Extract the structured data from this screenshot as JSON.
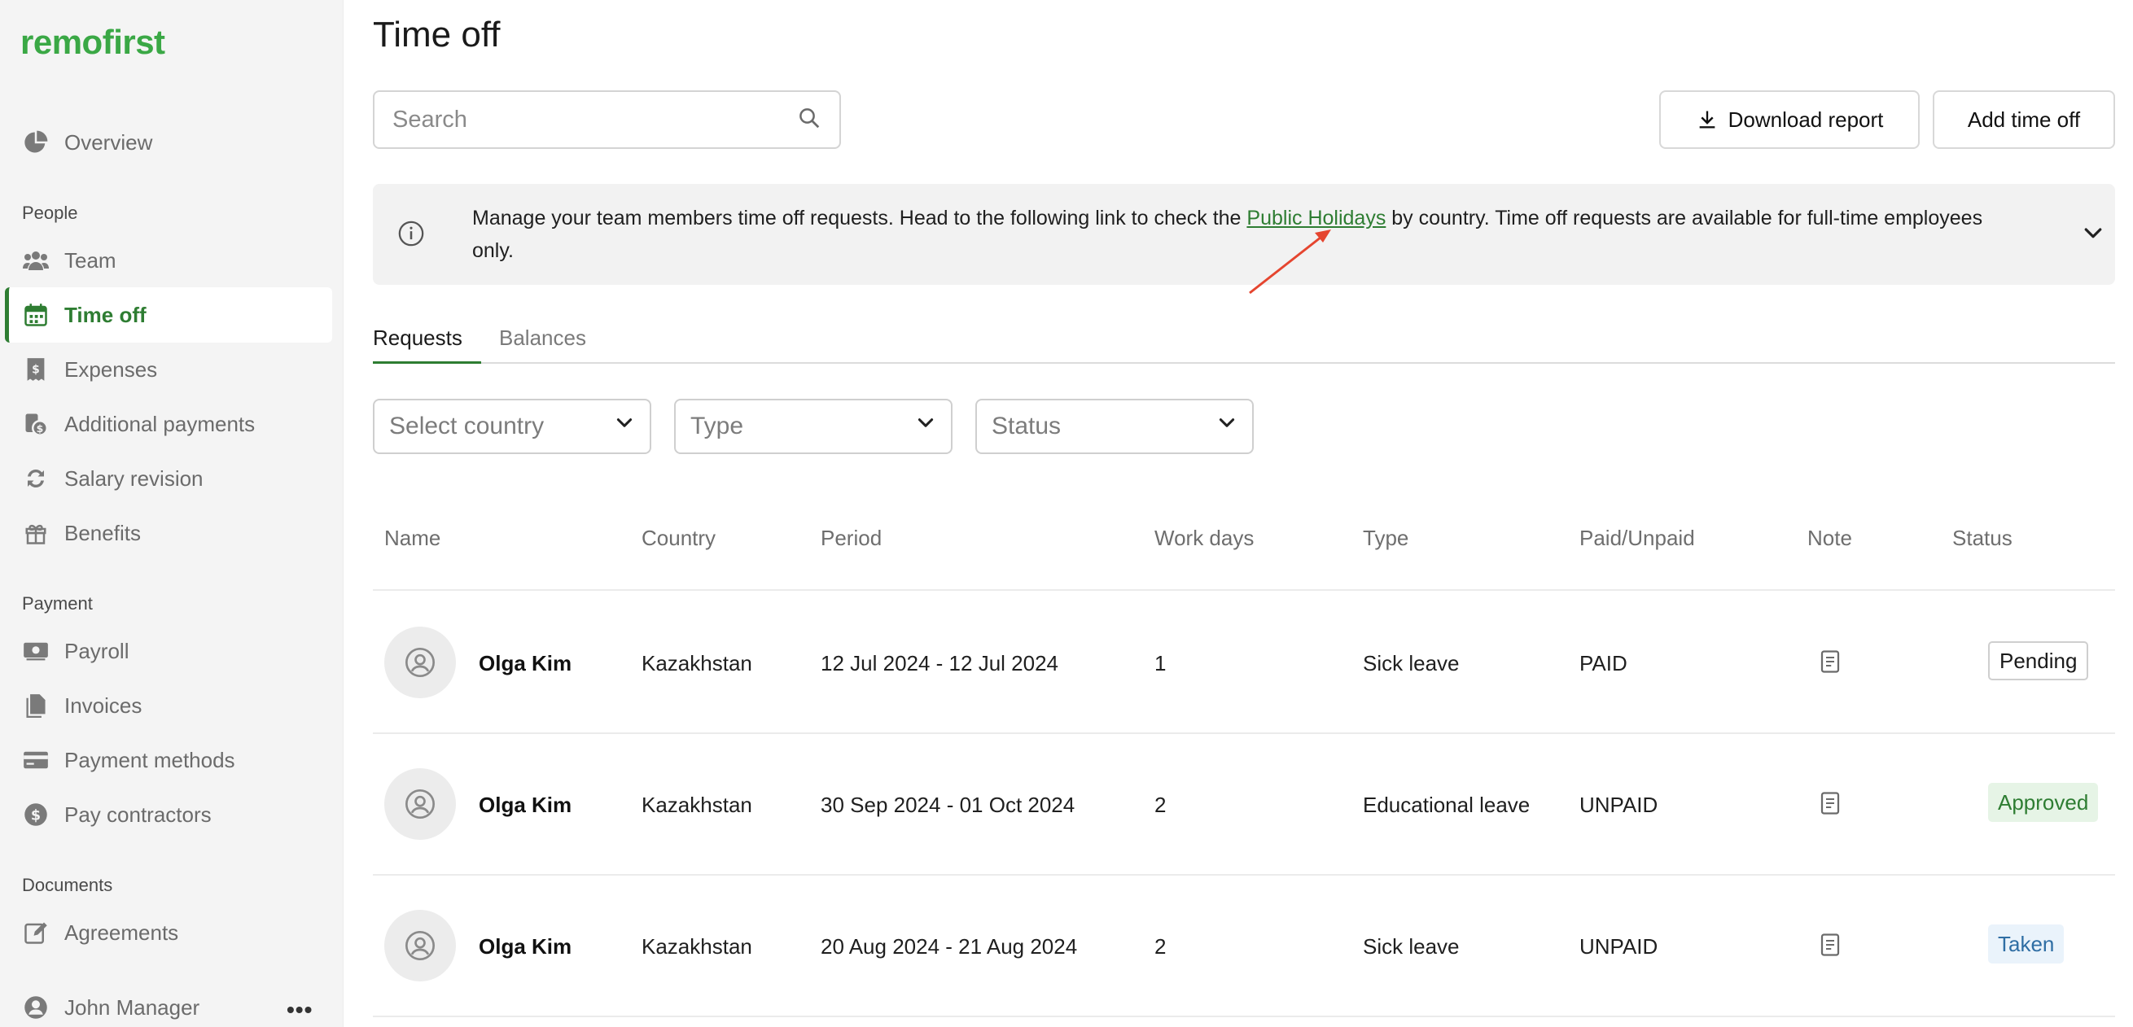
{
  "app": {
    "logo_text": "remofirst",
    "brand_color": "#3aa845",
    "accent_color": "#2e7d32"
  },
  "sidebar": {
    "overview": {
      "label": "Overview",
      "icon": "pie-chart-icon"
    },
    "sections": {
      "people": "People",
      "payment": "Payment",
      "documents": "Documents"
    },
    "items": [
      {
        "label": "Team",
        "icon": "team-icon"
      },
      {
        "label": "Time off",
        "icon": "calendar-icon",
        "active": true
      },
      {
        "label": "Expenses",
        "icon": "receipt-icon"
      },
      {
        "label": "Additional payments",
        "icon": "coins-icon"
      },
      {
        "label": "Salary revision",
        "icon": "refresh-icon"
      },
      {
        "label": "Benefits",
        "icon": "gift-icon"
      },
      {
        "label": "Payroll",
        "icon": "money-icon"
      },
      {
        "label": "Invoices",
        "icon": "document-icon"
      },
      {
        "label": "Payment methods",
        "icon": "credit-card-icon"
      },
      {
        "label": "Pay contractors",
        "icon": "dollar-icon"
      },
      {
        "label": "Agreements",
        "icon": "edit-icon"
      }
    ],
    "user": {
      "name": "John Manager",
      "icon": "user-icon"
    }
  },
  "header": {
    "title": "Time off",
    "search_placeholder": "Search",
    "download_label": "Download report",
    "add_label": "Add time off"
  },
  "info": {
    "text_before": "Manage your team members time off requests. Head to the following link to check the ",
    "link": "Public Holidays",
    "text_after": " by country. Time off requests are available for full-time employees only."
  },
  "tabs": {
    "requests": "Requests",
    "balances": "Balances"
  },
  "filters": {
    "country": "Select country",
    "type": "Type",
    "status": "Status"
  },
  "table": {
    "columns": [
      "Name",
      "Country",
      "Period",
      "Work days",
      "Type",
      "Paid/Unpaid",
      "Note",
      "Status"
    ],
    "rows": [
      {
        "name": "Olga Kim",
        "country": "Kazakhstan",
        "period": "12 Jul 2024 - 12 Jul 2024",
        "work_days": "1",
        "type": "Sick leave",
        "paid": "PAID",
        "status": "Pending"
      },
      {
        "name": "Olga Kim",
        "country": "Kazakhstan",
        "period": "30 Sep 2024 - 01 Oct 2024",
        "work_days": "2",
        "type": "Educational leave",
        "paid": "UNPAID",
        "status": "Approved"
      },
      {
        "name": "Olga Kim",
        "country": "Kazakhstan",
        "period": "20 Aug 2024 - 21 Aug 2024",
        "work_days": "2",
        "type": "Sick leave",
        "paid": "UNPAID",
        "status": "Taken"
      }
    ]
  }
}
